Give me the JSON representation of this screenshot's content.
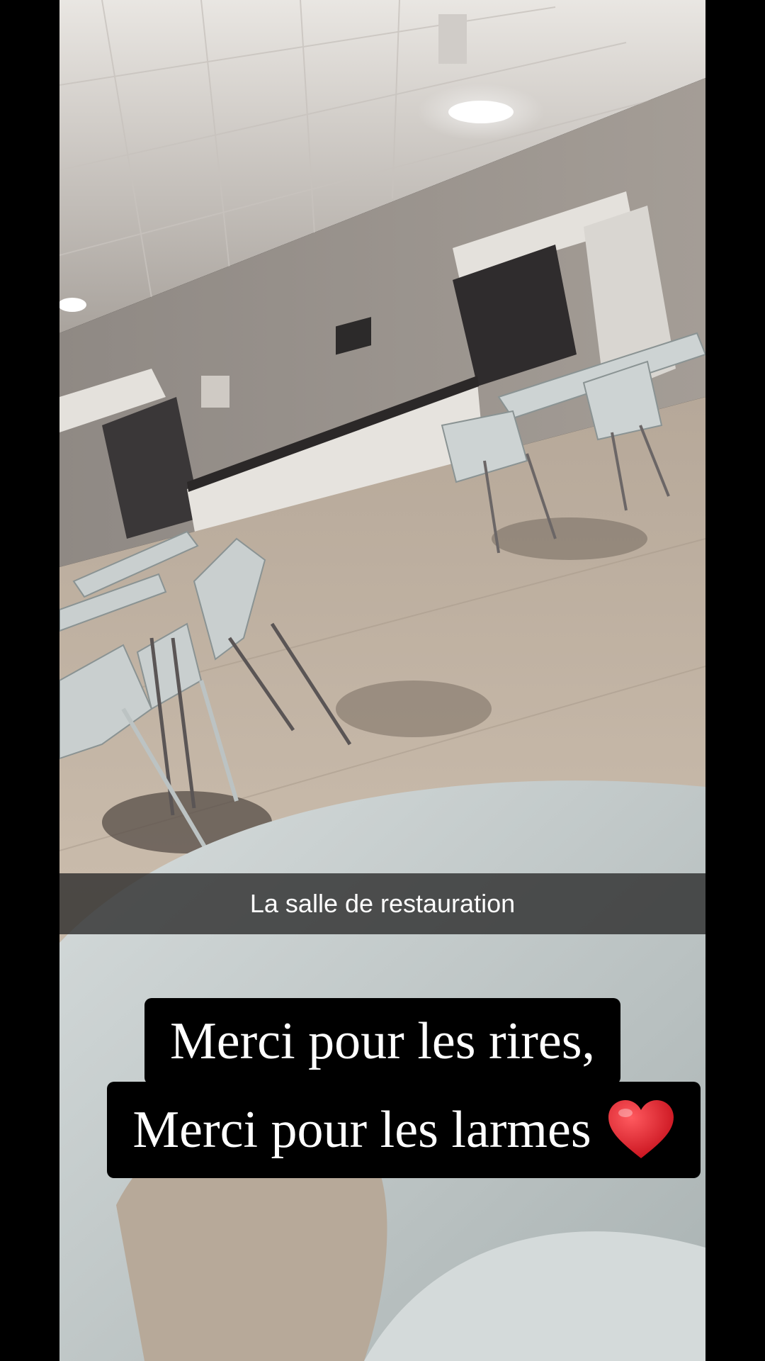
{
  "caption": {
    "text": "La salle de restauration"
  },
  "quote": {
    "line1": "Merci pour les rires,",
    "line2": "Merci pour les larmes"
  },
  "icons": {
    "heart": "red-heart-emoji"
  },
  "colors": {
    "heart": "#e0141e",
    "caption_bar": "#282828"
  }
}
